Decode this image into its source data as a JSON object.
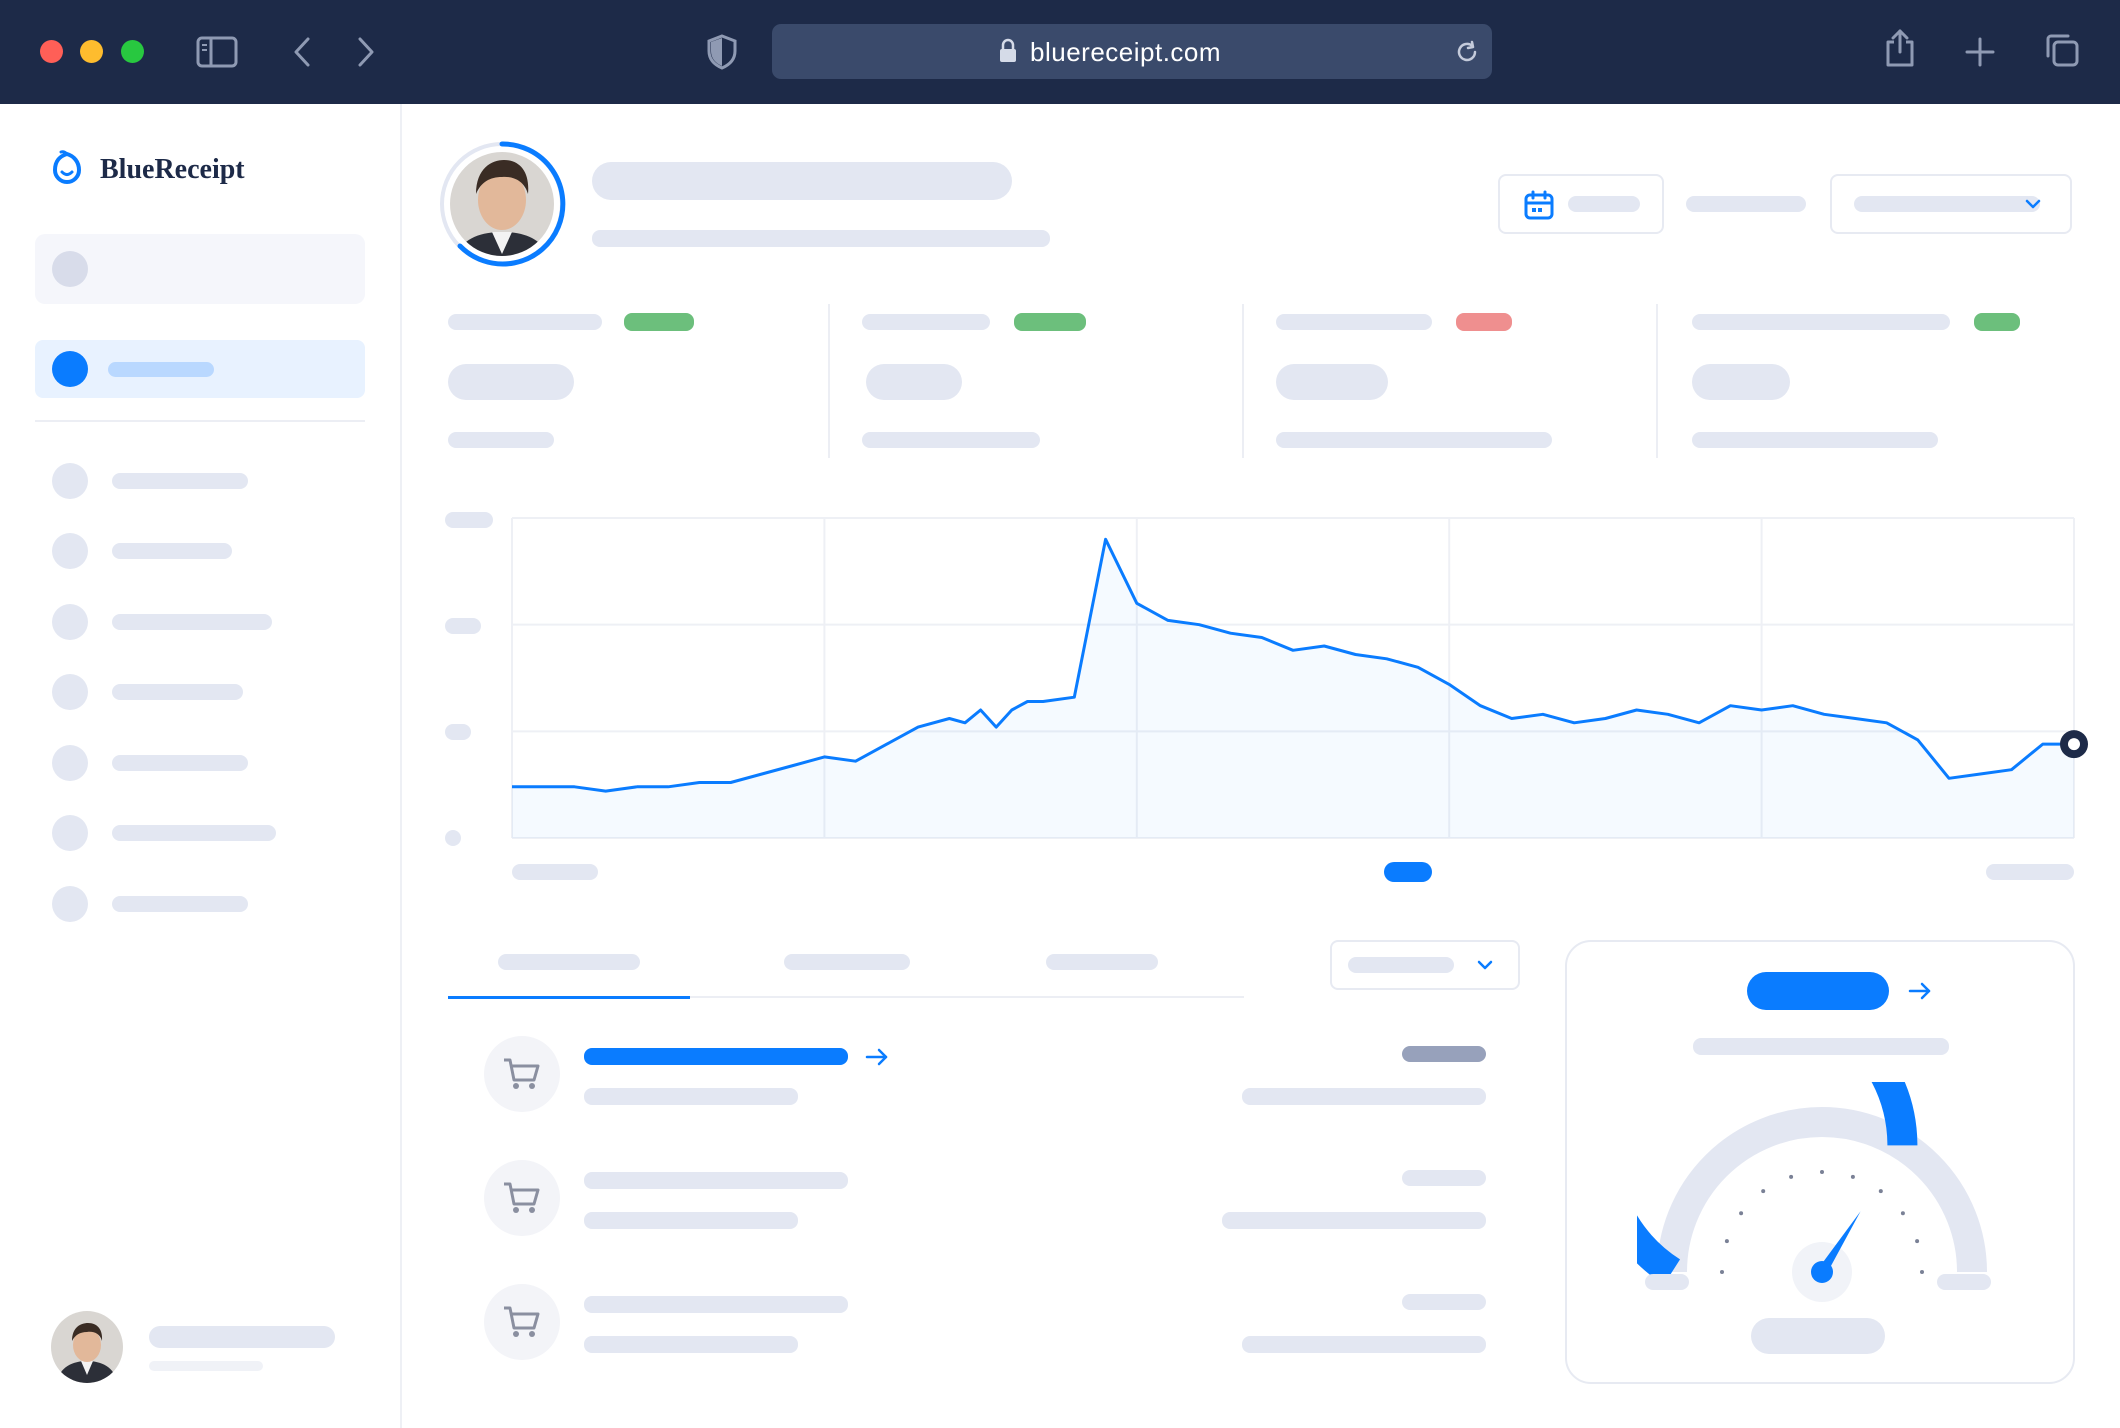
{
  "browser": {
    "url": "bluereceipt.com"
  },
  "brand": {
    "name": "BlueReceipt",
    "accent": "#0a7cff",
    "navy": "#1d2a48"
  },
  "icons": {
    "sidebar_toggle": "sidebar-toggle-icon",
    "back": "chevron-left-icon",
    "forward": "chevron-right-icon",
    "shield": "shield-icon",
    "lock": "lock-icon",
    "reload": "reload-icon",
    "share": "share-icon",
    "new_tab": "plus-icon",
    "tabs": "tabs-overview-icon",
    "calendar": "calendar-icon",
    "cart": "cart-icon",
    "arrow": "arrow-right-icon",
    "gauge": "gauge-icon"
  },
  "chart_data": {
    "type": "line",
    "x": [
      0,
      2,
      4,
      6,
      8,
      10,
      12,
      14,
      16,
      18,
      20,
      22,
      24,
      26,
      28,
      29,
      30,
      31,
      32,
      33,
      34,
      36,
      38,
      40,
      42,
      44,
      46,
      48,
      50,
      52,
      54,
      56,
      58,
      60,
      62,
      64,
      66,
      68,
      70,
      72,
      74,
      76,
      78,
      80,
      82,
      84,
      86,
      88,
      90,
      92,
      94,
      96,
      98,
      100
    ],
    "y": [
      12,
      12,
      12,
      11,
      12,
      12,
      13,
      13,
      15,
      17,
      19,
      18,
      22,
      26,
      28,
      27,
      30,
      26,
      30,
      32,
      32,
      33,
      70,
      55,
      51,
      50,
      48,
      47,
      44,
      45,
      43,
      42,
      40,
      36,
      31,
      28,
      29,
      27,
      28,
      30,
      29,
      27,
      31,
      30,
      31,
      29,
      28,
      27,
      23,
      14,
      15,
      16,
      22,
      22
    ],
    "series": [
      {
        "values_ref": "y",
        "color": "#0a7cff"
      }
    ],
    "xlim": [
      0,
      100
    ],
    "ylim": [
      0,
      75
    ],
    "grid": true,
    "current_marker_color": "#1d2a48"
  },
  "gauge": {
    "value_fraction": 0.68,
    "fill_color": "#0a7cff",
    "track_color": "#e3e7f2"
  },
  "tabs": {
    "active_index": 0
  }
}
